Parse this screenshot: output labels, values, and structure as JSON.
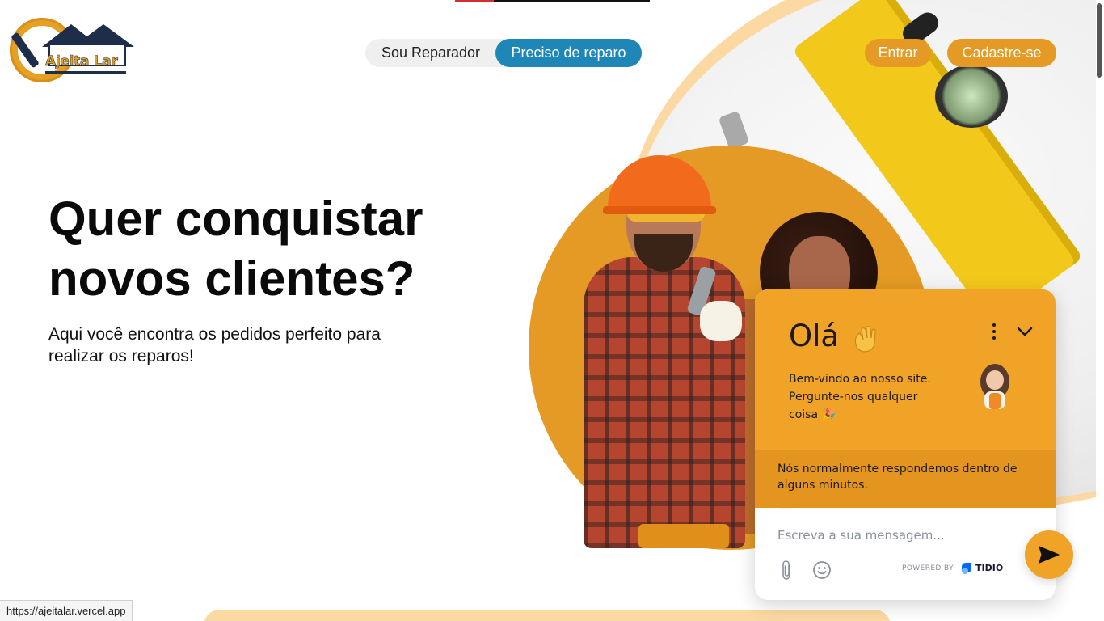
{
  "header": {
    "logo_text": "Ajeita Lar",
    "toggle": {
      "left_label": "Sou Reparador",
      "right_label": "Preciso de reparo"
    },
    "login_label": "Entrar",
    "signup_label": "Cadastre-se"
  },
  "hero": {
    "title_line1": "Quer conquistar",
    "title_line2": "novos clientes?",
    "subtitle": "Aqui você encontra os pedidos perfeito para realizar os reparos!"
  },
  "chat": {
    "greeting": "Olá",
    "greeting_emoji": "👋",
    "welcome_text": "Bem-vindo ao nosso site. Pergunte-nos qualquer coisa",
    "welcome_emoji": "🎉",
    "response_text": "Nós normalmente respondemos dentro de alguns minutos.",
    "input_placeholder": "Escreva a sua mensagem...",
    "powered_by": "POWERED BY",
    "brand": "TIDIO",
    "icons": [
      "wave-icon",
      "more-vertical-icon",
      "chevron-down-icon",
      "paperclip-icon",
      "smiley-icon",
      "send-icon"
    ]
  },
  "status_bar": {
    "url": "https://ajeitalar.vercel.app"
  },
  "colors": {
    "accent_orange": "#e49a24",
    "chat_orange": "#f0a326",
    "toggle_blue": "#1f86b8",
    "peach": "#fcd9a3"
  }
}
